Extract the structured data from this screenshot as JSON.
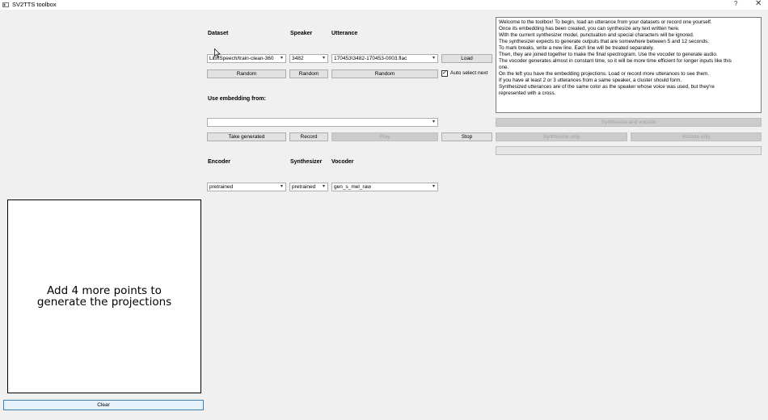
{
  "window": {
    "title": "SV2TTS toolbox",
    "help_glyph": "?",
    "close_glyph": "✕"
  },
  "labels": {
    "dataset": "Dataset",
    "speaker": "Speaker",
    "utterance": "Utterance",
    "use_embedding_from": "Use embedding from:",
    "encoder": "Encoder",
    "synthesizer": "Synthesizer",
    "vocoder": "Vocoder"
  },
  "combos": {
    "dataset": "LibriSpeech/train-clean-360",
    "speaker": "3482",
    "utterance": "170453\\3482-170453-0003.flac",
    "embedding": "",
    "encoder": "pretrained",
    "synthesizer": "pretrained",
    "vocoder": "gen_s_mel_raw",
    "arrow": "▾"
  },
  "buttons": {
    "load": "Load",
    "random_dataset": "Random",
    "random_speaker": "Random",
    "random_utterance": "Random",
    "auto_select_next": "Auto select next",
    "take_generated": "Take generated",
    "record": "Record",
    "play": "Play",
    "stop": "Stop",
    "synthesize_and_vocode": "Synthesize and vocode",
    "synthesize_only": "Synthesize only",
    "vocode_only": "Vocode only",
    "clear": "Clear"
  },
  "auto_select_checked": true,
  "check_mark": "✓",
  "text_input": [
    "Welcome to the toolbox! To begin, load an utterance from your datasets or record one yourself.",
    "Once its embedding has been created, you can synthesize any text written here.",
    "With the current synthesizer model, punctuation and special characters will be ignored.",
    "The synthesizer expects to generate outputs that are somewhere between 5 and 12 seconds.",
    "To mark breaks, write a new line. Each line will be treated separately.",
    "Then, they are joined together to make the final spectrogram. Use the vocoder to generate audio.",
    "The vocoder generates almost in constant time, so it will be more time efficient for longer inputs like this",
    "one.",
    "On the left you have the embedding projections. Load or record more utterances to see them.",
    "If you have at least 2 or 3 utterances from a same speaker, a cluster should form.",
    "Synthesized utterances are of the same color as the speaker whose voice was used, but they're",
    "represented with a cross."
  ],
  "projection_message": "Add 4 more points to generate the projections",
  "icons": {
    "app": "window-icon",
    "cursor": "mouse-pointer-icon"
  },
  "colors": {
    "background": "#f0f0f0",
    "button": "#e1e1e1",
    "disabled_text": "#a0a0a0",
    "focus_border": "#3c7fb1"
  }
}
